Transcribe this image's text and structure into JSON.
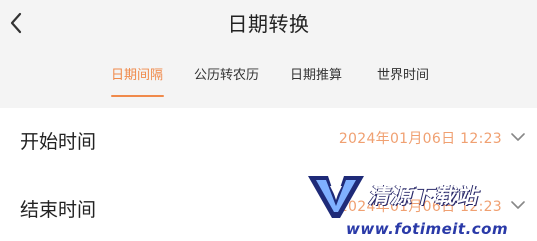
{
  "header": {
    "title": "日期转换",
    "back_icon": "chevron-left-icon"
  },
  "tabs": [
    {
      "label": "日期间隔",
      "active": true
    },
    {
      "label": "公历转农历",
      "active": false
    },
    {
      "label": "日期推算",
      "active": false
    },
    {
      "label": "世界时间",
      "active": false
    }
  ],
  "rows": [
    {
      "label": "开始时间",
      "value": "2024年01月06日 12:23"
    },
    {
      "label": "结束时间",
      "value": "2024年01月06日 12:23"
    }
  ],
  "watermark": {
    "text": "清源下载站",
    "url": "www.fotimeit.com"
  },
  "colors": {
    "accent": "#f08a4b",
    "value_text": "#f0a071",
    "background": "#f4f4f4",
    "panel": "#ffffff"
  }
}
